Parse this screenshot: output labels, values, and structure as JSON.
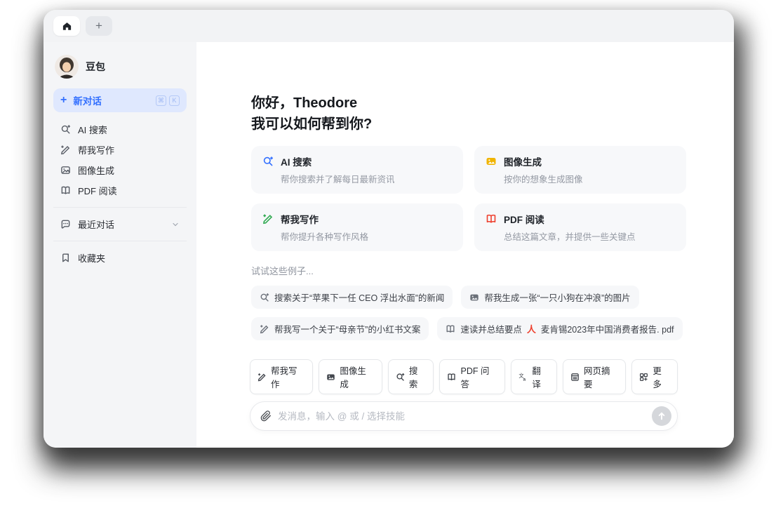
{
  "theme": {
    "accent_blue": "#3370ff",
    "active_item_bg": "#dfe8fe",
    "icon_yellow": "#f0b400",
    "icon_green": "#2ea94f",
    "icon_red": "#ee3f2d",
    "sidebar_bg": "#f4f5f7",
    "card_bg": "#f7f8fa"
  },
  "window": {
    "tabs": {
      "plus_label": "+"
    }
  },
  "sidebar": {
    "profile": {
      "name": "豆包"
    },
    "new_chat": {
      "label": "新对话",
      "shortcut_keys": [
        "⌘",
        "K"
      ]
    },
    "items": [
      {
        "icon": "ai-search-icon",
        "label": "AI 搜索"
      },
      {
        "icon": "write-icon",
        "label": "帮我写作"
      },
      {
        "icon": "image-icon",
        "label": "图像生成"
      },
      {
        "icon": "book-icon",
        "label": "PDF 阅读"
      }
    ],
    "sections": [
      {
        "icon": "chat-bubble-icon",
        "label": "最近对话"
      },
      {
        "icon": "bookmark-icon",
        "label": "收藏夹"
      }
    ]
  },
  "main": {
    "greeting_line1": "你好，Theodore",
    "greeting_line2": "我可以如何帮到你?",
    "feature_cards": [
      {
        "icon": "ai-search-icon",
        "title": "AI 搜索",
        "subtitle": "帮你搜索并了解每日最新资讯"
      },
      {
        "icon": "image-icon",
        "title": "图像生成",
        "subtitle": "按你的想象生成图像"
      },
      {
        "icon": "write-icon",
        "title": "帮我写作",
        "subtitle": "帮你提升各种写作风格"
      },
      {
        "icon": "book-icon",
        "title": "PDF 阅读",
        "subtitle": "总结这篇文章，并提供一些关键点"
      }
    ],
    "examples_label": "试试这些例子...",
    "example_chips": [
      {
        "icon": "ai-search-icon",
        "text": "搜索关于“苹果下一任 CEO 浮出水面”的新闻"
      },
      {
        "icon": "image-icon",
        "text": "帮我生成一张“一只小狗在冲浪”的图片"
      },
      {
        "icon": "write-icon",
        "text": "帮我写一个关于“母亲节”的小红书文案"
      },
      {
        "icon": "book-icon",
        "text_prefix": "速读并总结要点",
        "file_icon": "pdf-file-icon",
        "file_name": "麦肯锡2023年中国消费者报告. pdf"
      }
    ],
    "skill_chips": [
      {
        "icon": "write-icon",
        "label": "帮我写作"
      },
      {
        "icon": "image-icon",
        "label": "图像生成"
      },
      {
        "icon": "ai-search-icon",
        "label": "搜索"
      },
      {
        "icon": "book-icon",
        "label": "PDF 问答"
      },
      {
        "icon": "translate-icon",
        "label": "翻译"
      },
      {
        "icon": "webpage-icon",
        "label": "网页摘要"
      },
      {
        "icon": "more-icon",
        "label": "更多"
      }
    ],
    "composer": {
      "placeholder": "发消息，输入 @ 或 / 选择技能"
    }
  }
}
